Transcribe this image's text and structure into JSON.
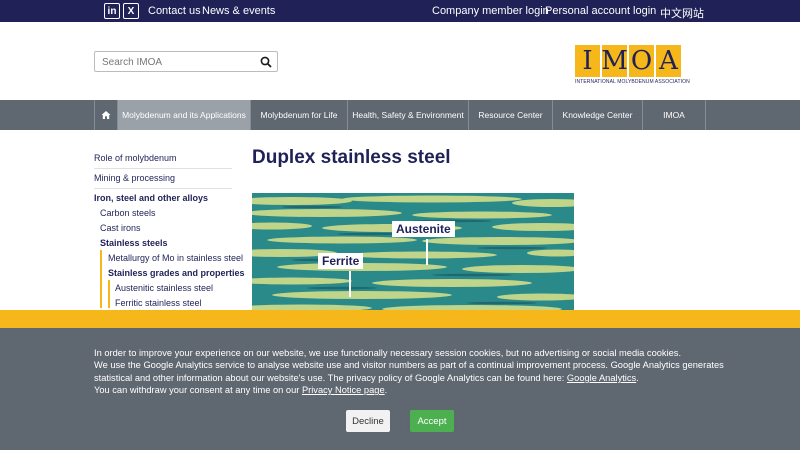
{
  "topbar": {
    "linkedin": "in",
    "x": "X",
    "contact": "Contact us",
    "news": "News & events",
    "company_login": "Company member login",
    "personal_login": "Personal account login",
    "chinese": "中文网站"
  },
  "search": {
    "placeholder": "Search IMOA"
  },
  "logo": {
    "letters": [
      "I",
      "M",
      "O",
      "A"
    ],
    "tagline": "INTERNATIONAL MOLYBDENUM ASSOCIATION"
  },
  "nav": {
    "items": [
      {
        "label": "Molybdenum and its Applications",
        "active": true
      },
      {
        "label": "Molybdenum for Life"
      },
      {
        "label": "Health, Safety & Environment"
      },
      {
        "label": "Resource Center"
      },
      {
        "label": "Knowledge Center"
      },
      {
        "label": "IMOA"
      }
    ]
  },
  "sidebar": {
    "items": [
      {
        "label": "Role of molybdenum"
      },
      {
        "label": "Mining & processing"
      },
      {
        "label": "Iron, steel and other alloys"
      },
      {
        "label": "Carbon steels"
      },
      {
        "label": "Cast irons"
      },
      {
        "label": "Stainless steels"
      },
      {
        "label": "Metallurgy of Mo in stainless steel"
      },
      {
        "label": "Stainless grades and properties"
      },
      {
        "label": "Austenitic stainless steel"
      },
      {
        "label": "Ferritic stainless steel"
      }
    ]
  },
  "main": {
    "title": "Duplex stainless steel",
    "image": {
      "label_austenite": "Austenite",
      "label_ferrite": "Ferrite"
    }
  },
  "cookie": {
    "line1": "In order to improve your experience on our website, we use functionally necessary session cookies, but no advertising or social media cookies.",
    "line2": "We use the Google Analytics service to analyse website use and visitor numbers as part of a continual improvement process. Google Analytics generates",
    "line3_text": "statistical and other information about our website's use. The privacy policy of Google Analytics can be found here: ",
    "line3_link": "Google Analytics",
    "line3_end": ".",
    "line4_text": "You can withdraw your consent at any time on our ",
    "line4_link": "Privacy Notice page",
    "line4_end": ".",
    "decline": "Decline",
    "accept": "Accept"
  },
  "colors": {
    "navy": "#1f2157",
    "gold": "#f5b71a",
    "nav_gray": "#5f6770",
    "accept_green": "#4caf50"
  }
}
